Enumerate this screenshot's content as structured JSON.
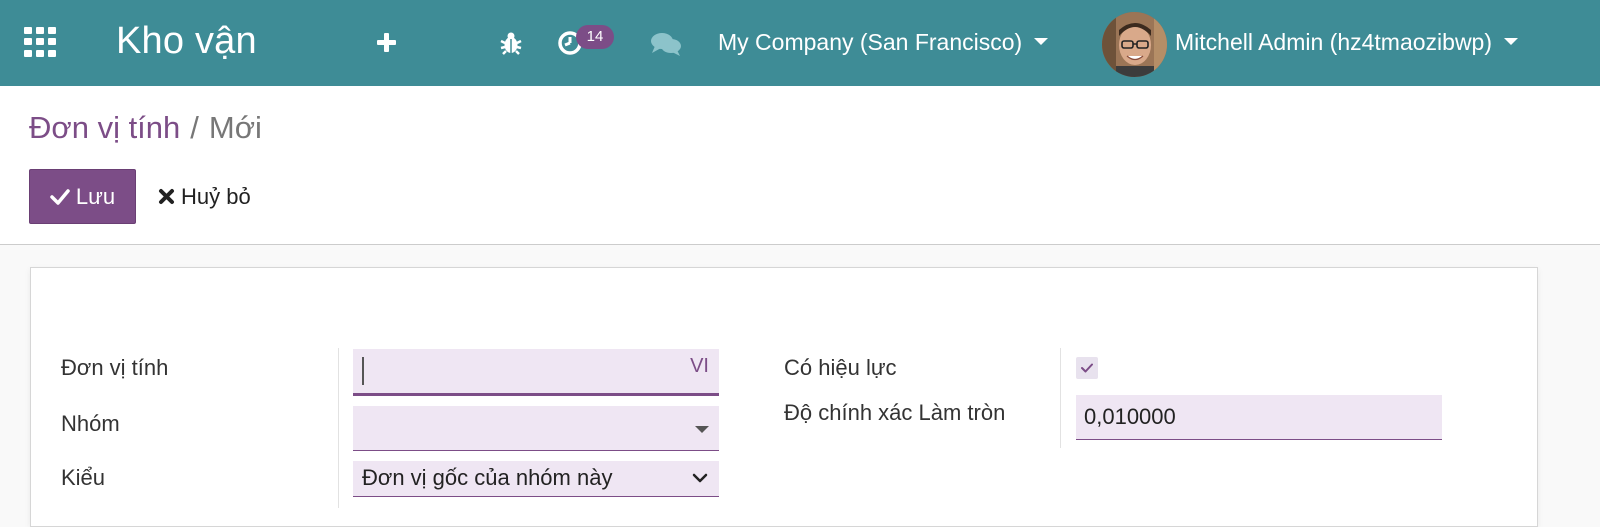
{
  "navbar": {
    "app_title": "Kho vận",
    "activity_count": "14",
    "company": "My Company (San Francisco)",
    "user": "Mitchell Admin (hz4tmaozibwp)",
    "bg_color": "#3e8c96",
    "icons": [
      "apps-grid-icon",
      "plus-icon",
      "bug-icon",
      "clock-icon",
      "chat-icon"
    ]
  },
  "breadcrumb": {
    "parent": "Đơn vị tính",
    "separator": "/",
    "current": "Mới"
  },
  "actions": {
    "save_label": "Lưu",
    "discard_label": "Huỷ bỏ",
    "accent_color": "#7c4d87"
  },
  "form": {
    "uom_name_label": "Đơn vị tính",
    "uom_name_value": "",
    "lang_badge": "VI",
    "category_label": "Nhóm",
    "category_value": "",
    "type_label": "Kiểu",
    "type_value": "Đơn vị gốc của nhóm này",
    "active_label": "Có hiệu lực",
    "active_checked": true,
    "rounding_label": "Độ chính xác Làm tròn",
    "rounding_value": "0,010000"
  }
}
